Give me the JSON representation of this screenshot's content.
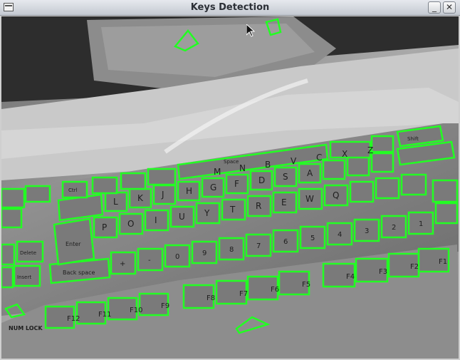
{
  "window": {
    "title": "Keys Detection",
    "menu_icon": "window-menu-icon",
    "minimize_icon": "minimize-icon",
    "close_icon": "close-icon",
    "minimize_glyph": "_",
    "close_glyph": "✕"
  },
  "colors": {
    "detection_outline": "#22ff22",
    "titlebar_top": "#e6e9ee",
    "titlebar_bottom": "#c4c9d1"
  },
  "canvas": {
    "content": "grayscale camera frame of a laptop keyboard with detected key outlines",
    "bottom_left_label": "NUM LOCK",
    "key_labels": {
      "function_row": [
        "F12",
        "F11",
        "F10",
        "F9",
        "F8",
        "F7",
        "F6",
        "F5",
        "F4",
        "F3",
        "F2",
        "F1"
      ],
      "number_row": [
        "Back space",
        "+",
        "-",
        "0",
        "9",
        "8",
        "7",
        "6",
        "5",
        "4",
        "3",
        "2",
        "1"
      ],
      "top_letter_row": [
        "Enter",
        "P",
        "O",
        "I",
        "U",
        "Y",
        "T",
        "R",
        "E",
        "W",
        "Q"
      ],
      "home_row": [
        "L",
        "K",
        "J",
        "H",
        "G",
        "F",
        "D",
        "S",
        "A"
      ],
      "bottom_letter_row": [
        "M",
        "N",
        "B",
        "V",
        "C",
        "X",
        "Z"
      ],
      "left_keys": [
        "Delete",
        "Insert"
      ],
      "other": [
        "Space",
        "Shift",
        "Ctrl"
      ]
    }
  }
}
